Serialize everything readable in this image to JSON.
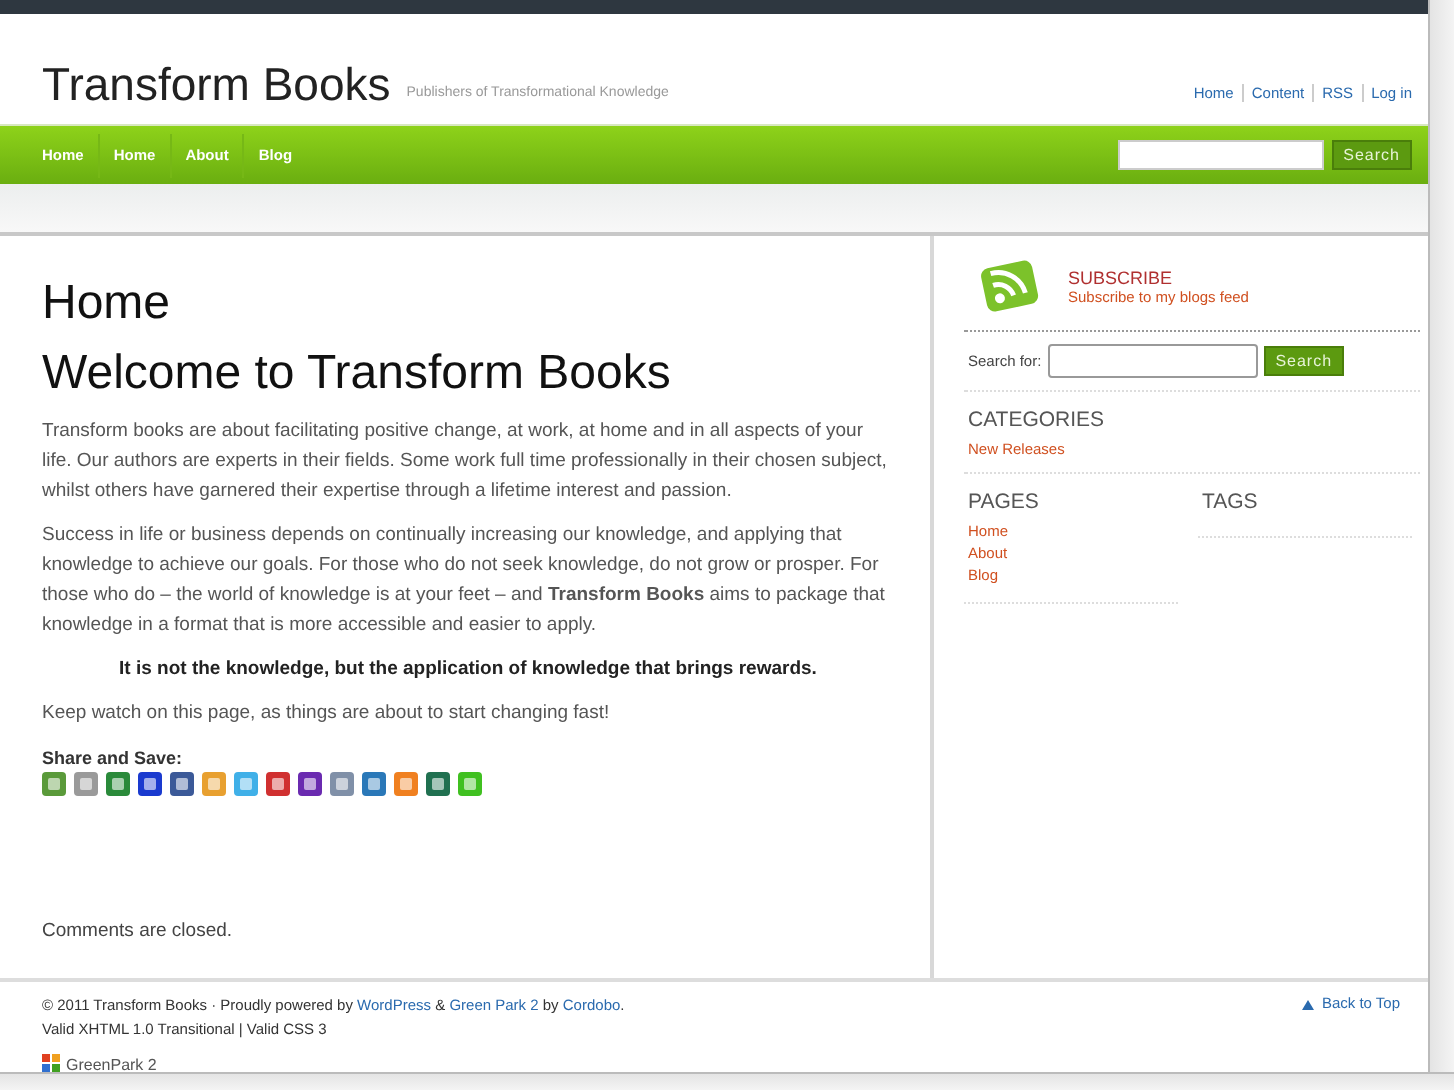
{
  "header": {
    "title": "Transform Books",
    "tagline": "Publishers of Transformational Knowledge",
    "top_links": [
      "Home",
      "Content",
      "RSS",
      "Log in"
    ]
  },
  "nav": {
    "items": [
      {
        "label": "Home"
      },
      {
        "label": "Home"
      },
      {
        "label": "About"
      },
      {
        "label": "Blog"
      }
    ],
    "search_button": "Search"
  },
  "main": {
    "page_title": "Home",
    "heading": "Welcome to Transform Books",
    "paragraphs": [
      {
        "kind": "normal",
        "text": "Transform books are about facilitating positive change, at work, at home and in all aspects of your life. Our authors are experts in their fields. Some work full time professionally in their chosen subject, whilst others have garnered their expertise through a lifetime interest and passion."
      },
      {
        "kind": "normal",
        "text": "Success in life or business depends on continually increasing our knowledge, and applying that knowledge to achieve our goals. For those who do not seek knowledge, do not grow or prosper. For those who do – the world of knowledge is at your feet – and **Transform Books** aims to package that knowledge in a format that is more accessible and easier to apply."
      },
      {
        "kind": "quote",
        "text": "It is not the knowledge, but the application of knowledge that brings rewards."
      },
      {
        "kind": "normal",
        "text": "Keep watch on this page, as things are about to start changing fast!"
      }
    ],
    "share_label": "Share and Save:",
    "share_icons": [
      {
        "color": "#5a9a3a"
      },
      {
        "color": "#9a9a9a"
      },
      {
        "color": "#2a8a3a"
      },
      {
        "color": "#1a3acf"
      },
      {
        "color": "#3b5998"
      },
      {
        "color": "#e8a030"
      },
      {
        "color": "#40b0e8"
      },
      {
        "color": "#d03030"
      },
      {
        "color": "#6a2ab0"
      },
      {
        "color": "#8090a8"
      },
      {
        "color": "#2a78b8"
      },
      {
        "color": "#f08020"
      },
      {
        "color": "#207050"
      },
      {
        "color": "#40c020"
      }
    ],
    "comments": "Comments are closed."
  },
  "sidebar": {
    "subscribe_title": "SUBSCRIBE",
    "subscribe_link": "Subscribe to my blogs feed",
    "search_label": "Search for:",
    "search_button": "Search",
    "categories": {
      "title": "CATEGORIES",
      "items": [
        "New Releases"
      ]
    },
    "pages": {
      "title": "PAGES",
      "items": [
        "Home",
        "About",
        "Blog"
      ]
    },
    "tags": {
      "title": "TAGS"
    }
  },
  "footer": {
    "parts": [
      {
        "kind": "text",
        "text": "© 2011 Transform Books · Proudly powered by "
      },
      {
        "kind": "link",
        "text": "WordPress"
      },
      {
        "kind": "text",
        "text": " & "
      },
      {
        "kind": "link",
        "text": "Green Park 2"
      },
      {
        "kind": "text",
        "text": " by "
      },
      {
        "kind": "link",
        "text": "Cordobo"
      },
      {
        "kind": "text",
        "text": "."
      }
    ],
    "validation": "Valid XHTML 1.0 Transitional | Valid CSS 3",
    "back_to_top": "Back to Top",
    "logo": "GreenPark 2"
  }
}
